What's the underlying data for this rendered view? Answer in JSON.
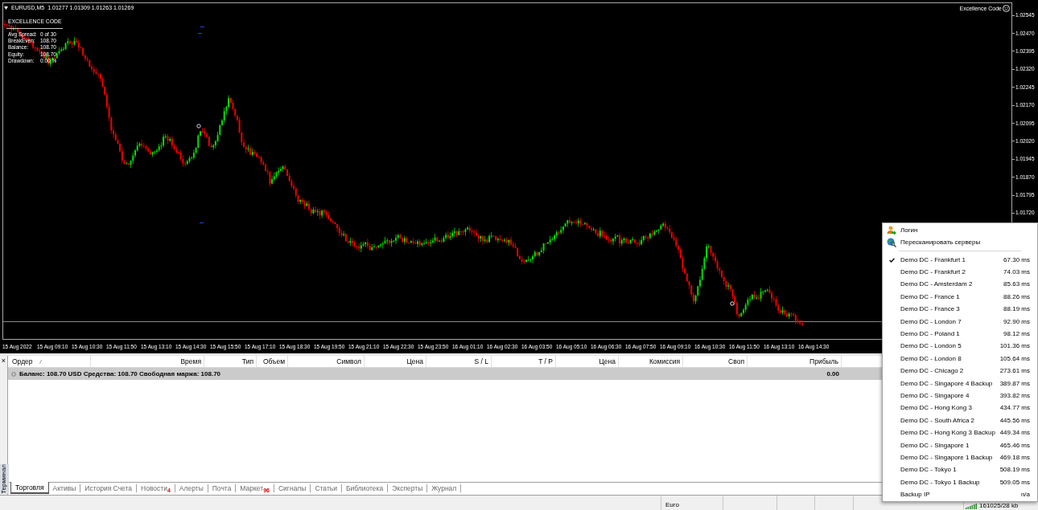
{
  "chart": {
    "symbol": "EURUSD,M5",
    "ohlc": "1.01277 1.01309 1.01263 1.01269",
    "brand": "Excellence Code",
    "indicator": {
      "title": "EXCELLENCE CODE",
      "rows": [
        {
          "label": "Avg Spread:",
          "value": "0 of 30"
        },
        {
          "label": "BreakEven:",
          "value": "108.70"
        },
        {
          "label": "Balance:",
          "value": "108.70"
        },
        {
          "label": "Equity:",
          "value": "108.70"
        },
        {
          "label": "Drawdown:",
          "value": "0.00 %"
        }
      ]
    },
    "price_axis": [
      "1.02545",
      "1.02470",
      "1.02395",
      "1.02320",
      "1.02245",
      "1.02170",
      "1.02095",
      "1.02020",
      "1.01945",
      "1.01870",
      "1.01795",
      "1.01720"
    ],
    "time_axis": [
      "15 Aug 2022",
      "15 Aug 09:10",
      "15 Aug 10:30",
      "15 Aug 11:50",
      "15 Aug 13:10",
      "15 Aug 14:30",
      "15 Aug 15:50",
      "15 Aug 17:10",
      "15 Aug 18:30",
      "15 Aug 19:50",
      "15 Aug 21:10",
      "15 Aug 22:30",
      "15 Aug 23:50",
      "16 Aug 01:10",
      "16 Aug 02:30",
      "16 Aug 03:50",
      "16 Aug 05:10",
      "16 Aug 06:30",
      "16 Aug 07:50",
      "16 Aug 09:10",
      "16 Aug 10:30",
      "16 Aug 11:50",
      "16 Aug 13:10",
      "16 Aug 14:30"
    ]
  },
  "terminal": {
    "close": "×",
    "title": "Терминал",
    "columns": [
      "Ордер",
      "Время",
      "Тип",
      "Объем",
      "Символ",
      "Цена",
      "S / L",
      "T / P",
      "Цена",
      "Комиссия",
      "Своп",
      "Прибыль"
    ],
    "balance": {
      "summary": "Баланс: 108.70 USD Средства: 108.70 Свободная маржа: 108.70",
      "profit": "0.00"
    },
    "tabs": [
      {
        "label": "Торговля",
        "selected": true
      },
      {
        "label": "Активы",
        "selected": false
      },
      {
        "label": "История Счета",
        "selected": false
      },
      {
        "label": "Новости",
        "count": "4",
        "selected": false
      },
      {
        "label": "Алерты",
        "selected": false
      },
      {
        "label": "Почта",
        "selected": false
      },
      {
        "label": "Маркет",
        "count": "96",
        "selected": false
      },
      {
        "label": "Сигналы",
        "selected": false
      },
      {
        "label": "Статьи",
        "selected": false
      },
      {
        "label": "Библиотека",
        "selected": false
      },
      {
        "label": "Эксперты",
        "selected": false
      },
      {
        "label": "Журнал",
        "selected": false
      }
    ]
  },
  "status_bar": {
    "cells": [
      "Euro"
    ],
    "traffic": "161025/28 kb"
  },
  "server_menu": {
    "actions": [
      {
        "kind": "login",
        "label": "Логин"
      },
      {
        "kind": "rescan",
        "label": "Пересканировать серверы"
      }
    ],
    "servers": [
      {
        "name": "Demo DC - Frankfurt 1",
        "ping": "67.30 ms",
        "selected": true
      },
      {
        "name": "Demo DC - Frankfurt 2",
        "ping": "74.03 ms",
        "selected": false
      },
      {
        "name": "Demo DC - Amsterdam 2",
        "ping": "85.63 ms",
        "selected": false
      },
      {
        "name": "Demo DC - France 1",
        "ping": "88.26 ms",
        "selected": false
      },
      {
        "name": "Demo DC - France 3",
        "ping": "88.19 ms",
        "selected": false
      },
      {
        "name": "Demo DC - London 7",
        "ping": "92.90 ms",
        "selected": false
      },
      {
        "name": "Demo DC - Poland 1",
        "ping": "98.12 ms",
        "selected": false
      },
      {
        "name": "Demo DC - London 5",
        "ping": "101.36 ms",
        "selected": false
      },
      {
        "name": "Demo DC - London 8",
        "ping": "105.64 ms",
        "selected": false
      },
      {
        "name": "Demo DC - Chicago 2",
        "ping": "273.61 ms",
        "selected": false
      },
      {
        "name": "Demo DC - Singapore 4 Backup",
        "ping": "389.87 ms",
        "selected": false
      },
      {
        "name": "Demo DC - Singapore 4",
        "ping": "393.82 ms",
        "selected": false
      },
      {
        "name": "Demo DC - Hong Kong 3",
        "ping": "434.77 ms",
        "selected": false
      },
      {
        "name": "Demo DC - South Africa 2",
        "ping": "445.56 ms",
        "selected": false
      },
      {
        "name": "Demo DC - Hong Kong 3 Backup",
        "ping": "449.34 ms",
        "selected": false
      },
      {
        "name": "Demo DC - Singapore 1",
        "ping": "465.46 ms",
        "selected": false
      },
      {
        "name": "Demo DC - Singapore 1 Backup",
        "ping": "469.18 ms",
        "selected": false
      },
      {
        "name": "Demo DC - Tokyo 1",
        "ping": "508.19 ms",
        "selected": false
      },
      {
        "name": "Demo DC - Tokyo 1 Backup",
        "ping": "509.05 ms",
        "selected": false
      },
      {
        "name": "Backup IP",
        "ping": "n/a",
        "selected": false
      }
    ]
  }
}
